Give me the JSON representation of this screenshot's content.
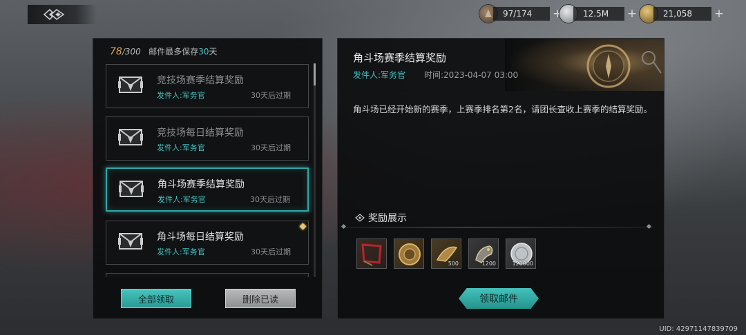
{
  "resources": [
    {
      "icon": "stamina-icon",
      "value": "97/174"
    },
    {
      "icon": "silver-coin-icon",
      "value": "12.5M"
    },
    {
      "icon": "gold-coin-icon",
      "value": "21,058"
    }
  ],
  "mailbox": {
    "count_current": "78",
    "count_max": "/300",
    "notice_prefix": "邮件最多保存",
    "notice_days": "30",
    "notice_suffix": "天"
  },
  "mails": [
    {
      "title": "竞技场赛季结算奖励",
      "sender": "发件人:军务官",
      "expire": "30天后过期",
      "read": true,
      "selected": false
    },
    {
      "title": "竞技场每日结算奖励",
      "sender": "发件人:军务官",
      "expire": "30天后过期",
      "read": true,
      "selected": false
    },
    {
      "title": "角斗场赛季结算奖励",
      "sender": "发件人:军务官",
      "expire": "30天后过期",
      "read": false,
      "selected": true
    },
    {
      "title": "角斗场每日结算奖励",
      "sender": "发件人:军务官",
      "expire": "30天后过期",
      "read": false,
      "selected": false
    }
  ],
  "buttons": {
    "claim_all": "全部领取",
    "delete_read": "删除已读",
    "claim_mail": "领取邮件"
  },
  "detail": {
    "title": "角斗场赛季结算奖励",
    "sender": "发件人:军务官",
    "time": "时间:2023-04-07 03:00",
    "body": "角斗场已经开始新的赛季，上赛季排名第2名，请团长查收上赛季的结算奖励。",
    "reward_heading": "奖励展示",
    "rewards": [
      {
        "icon": "red-banner-icon",
        "qty": ""
      },
      {
        "icon": "gold-medallion-icon",
        "qty": ""
      },
      {
        "icon": "bronze-horn-icon",
        "qty": "500"
      },
      {
        "icon": "beast-claw-icon",
        "qty": "1200"
      },
      {
        "icon": "silver-coin-icon",
        "qty": "120000"
      }
    ]
  },
  "uid": "UID: 42971147839709",
  "colors": {
    "accent": "#3fc3c3",
    "gold": "#d8aa5a"
  }
}
